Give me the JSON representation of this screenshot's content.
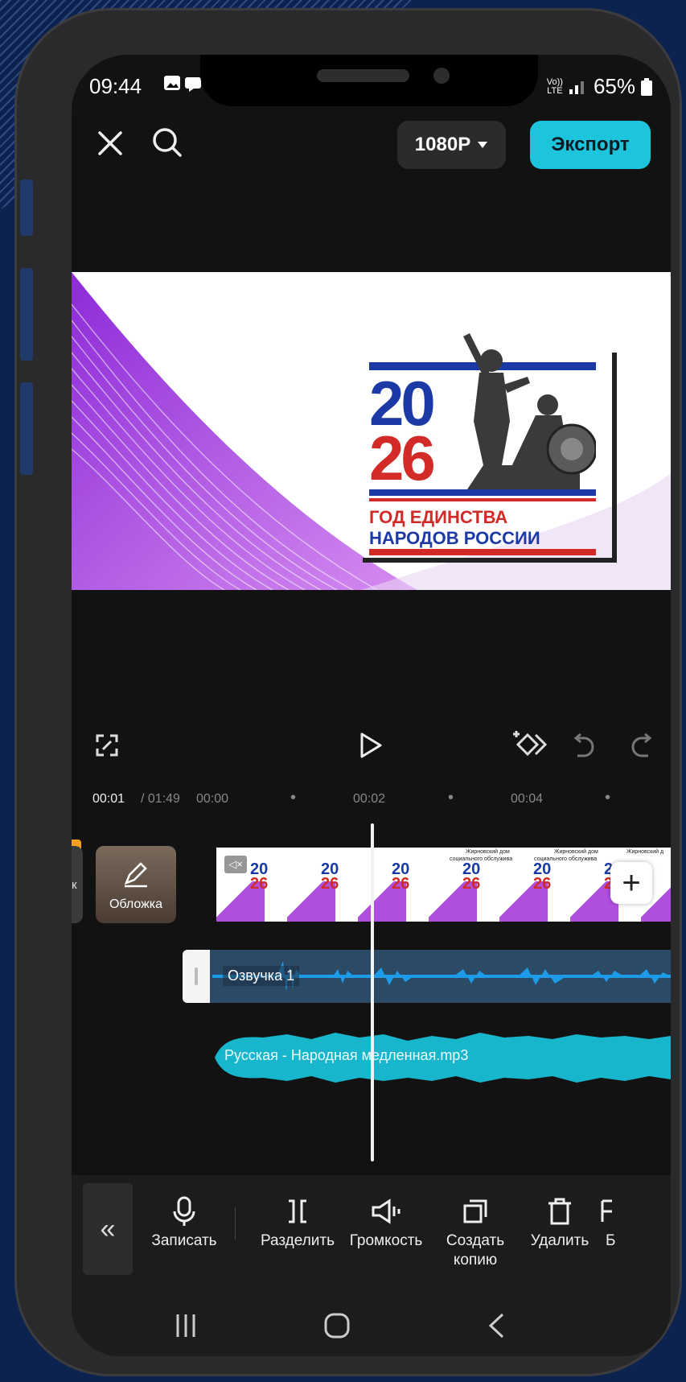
{
  "status_bar": {
    "time": "09:44",
    "network_top": "Vo))",
    "network_bottom": "LTE",
    "battery": "65%"
  },
  "topbar": {
    "close_icon": "close-icon",
    "search_icon": "search-icon",
    "resolution": "1080P",
    "export_label": "Экспорт",
    "export_color": "#1cc5dc"
  },
  "preview": {
    "year_top": "20",
    "year_bottom": "26",
    "line1": "ГОД ЕДИНСТВА",
    "line2": "НАРОДОВ РОССИИ"
  },
  "timeline": {
    "current_time": "00:01",
    "total_time": "/ 01:49",
    "ticks": [
      "00:00",
      "00:02",
      "00:04"
    ],
    "cover_label": "Обложка",
    "left_partial_label": "к",
    "clip_captions": [
      "Жирновский дом",
      "социального обслужива",
      "Жирновский дом",
      "социального обслужива",
      "Жирновский д"
    ],
    "voice_label": "Озвучка 1",
    "music_label": "Русская - Народная медленная.mp3",
    "voice_color": "#1e9be8",
    "music_color": "#17b6cc"
  },
  "toolbar": {
    "items": [
      {
        "label": "Записать",
        "icon": "microphone-icon"
      },
      {
        "label": "Разделить",
        "icon": "split-icon"
      },
      {
        "label": "Громкость",
        "icon": "volume-icon"
      },
      {
        "label": "Создать копию",
        "icon": "duplicate-icon"
      },
      {
        "label": "Удалить",
        "icon": "trash-icon"
      },
      {
        "label": "Б",
        "icon": "partial-icon"
      }
    ]
  }
}
